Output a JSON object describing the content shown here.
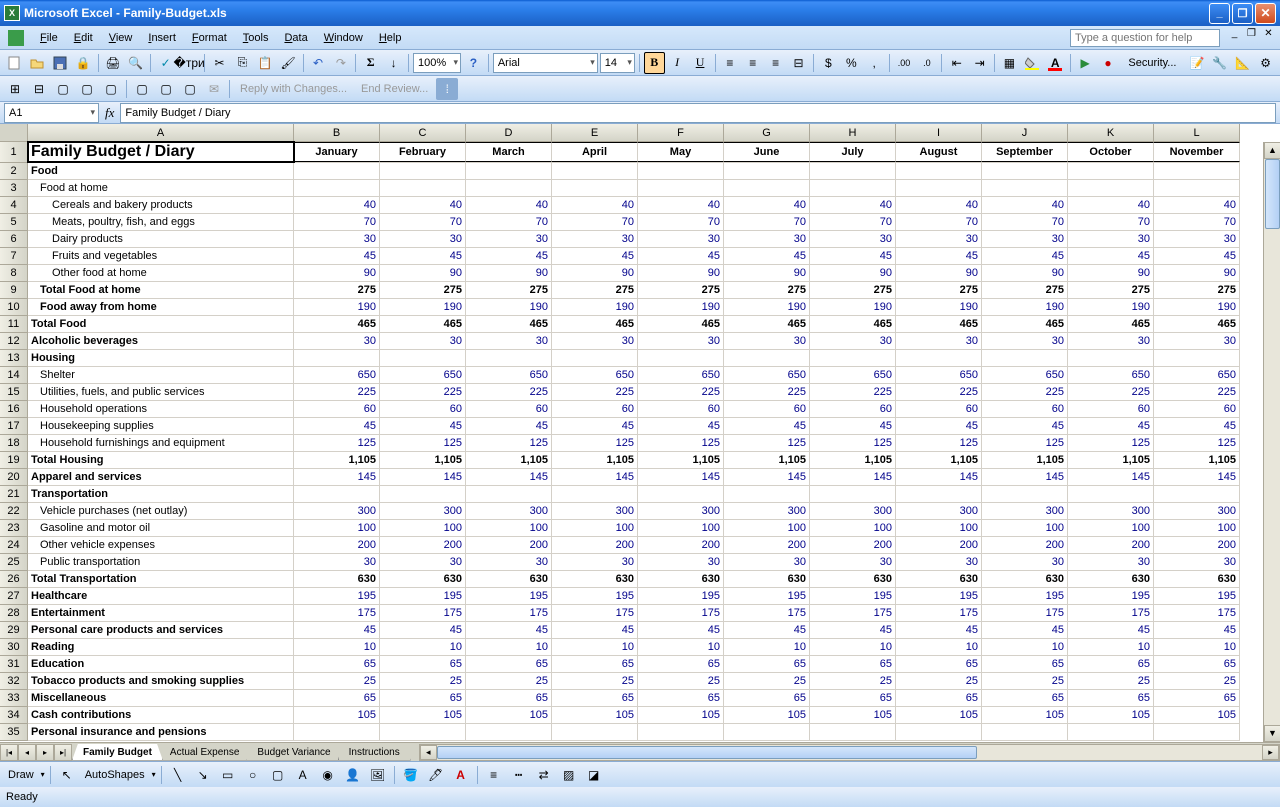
{
  "title": "Microsoft Excel - Family-Budget.xls",
  "menus": [
    "File",
    "Edit",
    "View",
    "Insert",
    "Format",
    "Tools",
    "Data",
    "Window",
    "Help"
  ],
  "help_placeholder": "Type a question for help",
  "zoom": "100%",
  "font_name": "Arial",
  "font_size": "14",
  "review": {
    "reply": "Reply with Changes...",
    "end": "End Review..."
  },
  "namebox": "A1",
  "formula": "Family Budget / Diary",
  "security_label": "Security...",
  "draw_label": "Draw",
  "autoshapes_label": "AutoShapes",
  "status": "Ready",
  "colWidths": {
    "A": 266,
    "other": 86
  },
  "columns": [
    "A",
    "B",
    "C",
    "D",
    "E",
    "F",
    "G",
    "H",
    "I",
    "J",
    "K",
    "L"
  ],
  "months": [
    "January",
    "February",
    "March",
    "April",
    "May",
    "June",
    "July",
    "August",
    "September",
    "October",
    "November"
  ],
  "tabs": [
    "Family Budget",
    "Actual Expense",
    "Budget Variance",
    "Instructions"
  ],
  "active_tab": 0,
  "rows": [
    {
      "n": 1,
      "a": "Family Budget / Diary",
      "cls": "first hdr-top"
    },
    {
      "n": 2,
      "a": "Food",
      "bold": true
    },
    {
      "n": 3,
      "a": "Food at home",
      "indent": 1
    },
    {
      "n": 4,
      "a": "Cereals and bakery products",
      "indent": 2,
      "v": 40,
      "num": true
    },
    {
      "n": 5,
      "a": "Meats, poultry, fish, and eggs",
      "indent": 2,
      "v": 70,
      "num": true
    },
    {
      "n": 6,
      "a": "Dairy products",
      "indent": 2,
      "v": 30,
      "num": true
    },
    {
      "n": 7,
      "a": "Fruits and vegetables",
      "indent": 2,
      "v": 45,
      "num": true
    },
    {
      "n": 8,
      "a": "Other food at home",
      "indent": 2,
      "v": 90,
      "num": true
    },
    {
      "n": 9,
      "a": "Total Food at home",
      "indent": 1,
      "bold": true,
      "v": 275,
      "tot": true
    },
    {
      "n": 10,
      "a": "Food away from home",
      "indent": 1,
      "bold": true,
      "v": 190,
      "num": true
    },
    {
      "n": 11,
      "a": "Total Food",
      "bold": true,
      "v": 465,
      "tot": true
    },
    {
      "n": 12,
      "a": "Alcoholic beverages",
      "bold": true,
      "v": 30,
      "num": true
    },
    {
      "n": 13,
      "a": "Housing",
      "bold": true
    },
    {
      "n": 14,
      "a": "Shelter",
      "indent": 1,
      "v": 650,
      "num": true
    },
    {
      "n": 15,
      "a": "Utilities, fuels, and public services",
      "indent": 1,
      "v": 225,
      "num": true
    },
    {
      "n": 16,
      "a": "Household operations",
      "indent": 1,
      "v": 60,
      "num": true
    },
    {
      "n": 17,
      "a": "Housekeeping supplies",
      "indent": 1,
      "v": 45,
      "num": true
    },
    {
      "n": 18,
      "a": "Household furnishings and equipment",
      "indent": 1,
      "v": 125,
      "num": true
    },
    {
      "n": 19,
      "a": "Total Housing",
      "bold": true,
      "v": "1,105",
      "tot": true
    },
    {
      "n": 20,
      "a": "Apparel and services",
      "bold": true,
      "v": 145,
      "num": true
    },
    {
      "n": 21,
      "a": "Transportation",
      "bold": true
    },
    {
      "n": 22,
      "a": "Vehicle purchases (net outlay)",
      "indent": 1,
      "v": 300,
      "num": true
    },
    {
      "n": 23,
      "a": "Gasoline and motor oil",
      "indent": 1,
      "v": 100,
      "num": true
    },
    {
      "n": 24,
      "a": "Other vehicle expenses",
      "indent": 1,
      "v": 200,
      "num": true
    },
    {
      "n": 25,
      "a": "Public transportation",
      "indent": 1,
      "v": 30,
      "num": true
    },
    {
      "n": 26,
      "a": "Total Transportation",
      "bold": true,
      "v": 630,
      "tot": true
    },
    {
      "n": 27,
      "a": "Healthcare",
      "bold": true,
      "v": 195,
      "num": true
    },
    {
      "n": 28,
      "a": "Entertainment",
      "bold": true,
      "v": 175,
      "num": true
    },
    {
      "n": 29,
      "a": "Personal care products and services",
      "bold": true,
      "v": 45,
      "num": true
    },
    {
      "n": 30,
      "a": "Reading",
      "bold": true,
      "v": 10,
      "num": true
    },
    {
      "n": 31,
      "a": "Education",
      "bold": true,
      "v": 65,
      "num": true
    },
    {
      "n": 32,
      "a": "Tobacco products and smoking supplies",
      "bold": true,
      "v": 25,
      "num": true
    },
    {
      "n": 33,
      "a": "Miscellaneous",
      "bold": true,
      "v": 65,
      "num": true
    },
    {
      "n": 34,
      "a": "Cash contributions",
      "bold": true,
      "v": 105,
      "num": true
    },
    {
      "n": 35,
      "a": "Personal insurance and pensions",
      "bold": true
    }
  ]
}
